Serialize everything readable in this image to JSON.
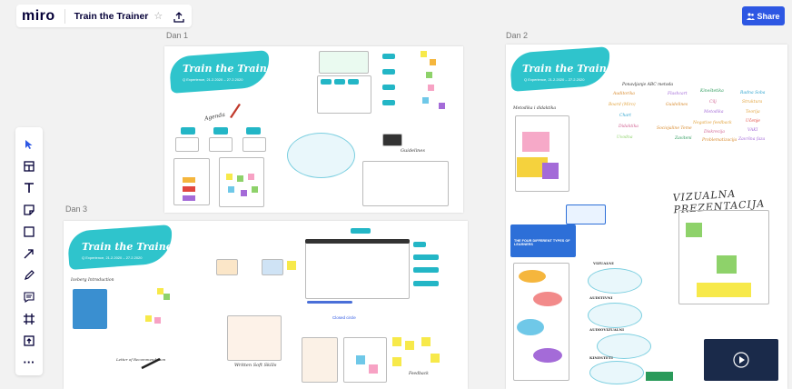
{
  "app": {
    "logo": "miro",
    "board_title": "Train the Trainer",
    "share_label": "Share"
  },
  "frames": [
    {
      "label": "Dan 1",
      "title": "Train the Trainer",
      "subtitle": "Q Experience, 21.2.2020 – 27.2.2020",
      "words": [
        "Agenda",
        "Guidelines"
      ]
    },
    {
      "label": "Dan 2",
      "title": "Train the Trainer",
      "subtitle": "Q Experience, 21.2.2020 – 27.2.2020",
      "words": [
        "Metodika i didaktika",
        "Ponavljanje ABC metoda",
        "VIZUALNA PREZENTACIJA",
        "VIZUALNI",
        "AUDITIVNI",
        "AUDIOVIZUALNI",
        "KINESTETI",
        "THE FOUR DIFFERENT TYPES OF LEARNERS"
      ],
      "abc_words": [
        "Auditorika",
        "Flashcart",
        "Kineštetika",
        "Radna Soba",
        "Board (Miro)",
        "Guidelines",
        "Cilj",
        "Struktura",
        "Chart",
        "Metodika",
        "Teorija",
        "Didaktika",
        "Negative feedback",
        "Učenje",
        "Uvodna",
        "Sociojaline Teme",
        "Diskrecija",
        "VAKI",
        "Zaviteni",
        "Problematizacija",
        "Završna faza"
      ]
    },
    {
      "label": "Dan 3",
      "title": "Train the Trainer",
      "subtitle": "Q Experience, 21.2.2020 – 27.2.2020",
      "words": [
        "Iceberg Introduction",
        "Letter of Recommendation",
        "Written Soft Skills",
        "Feedback",
        "Closed circle"
      ]
    }
  ],
  "toolbar": [
    "select-icon",
    "templates-icon",
    "text-icon",
    "sticky-note-icon",
    "shape-icon",
    "connector-icon",
    "pen-icon",
    "comment-icon",
    "frame-icon",
    "upload-icon",
    "more-icon"
  ]
}
